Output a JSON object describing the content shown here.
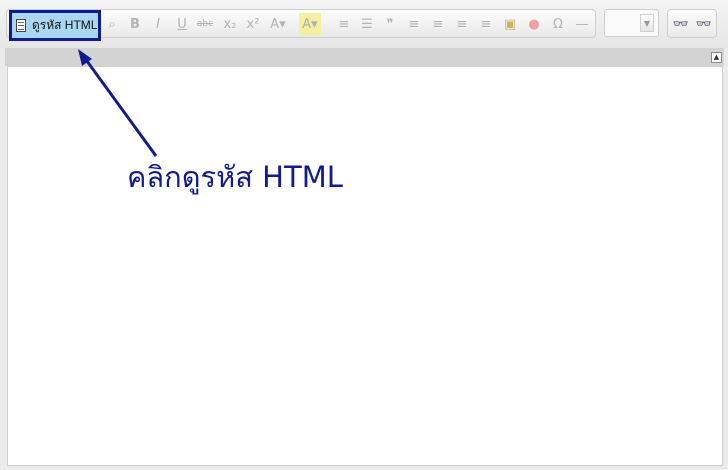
{
  "toolbar": {
    "source_label": "ดูรหัส HTML",
    "buttons": [
      {
        "name": "preview-icon",
        "glyph": "⌕"
      },
      {
        "name": "bold-icon",
        "glyph": "B"
      },
      {
        "name": "italic-icon",
        "glyph": "I"
      },
      {
        "name": "underline-icon",
        "glyph": "U"
      },
      {
        "name": "strikethrough-icon",
        "glyph": "abc"
      },
      {
        "name": "subscript-icon",
        "glyph": "x₂"
      },
      {
        "name": "superscript-icon",
        "glyph": "x²"
      },
      {
        "name": "text-color-icon",
        "glyph": "A▾"
      },
      {
        "name": "background-color-icon",
        "glyph": "A▾"
      },
      {
        "name": "numbered-list-icon",
        "glyph": "≡"
      },
      {
        "name": "bulleted-list-icon",
        "glyph": "☰"
      },
      {
        "name": "blockquote-icon",
        "glyph": "❞"
      },
      {
        "name": "align-left-icon",
        "glyph": "≡"
      },
      {
        "name": "align-center-icon",
        "glyph": "≡"
      },
      {
        "name": "align-right-icon",
        "glyph": "≡"
      },
      {
        "name": "justify-icon",
        "glyph": "≡"
      },
      {
        "name": "image-icon",
        "glyph": "▣"
      },
      {
        "name": "flash-icon",
        "glyph": "●"
      },
      {
        "name": "special-character-icon",
        "glyph": "Ω"
      },
      {
        "name": "horizontal-rule-icon",
        "glyph": "—"
      }
    ],
    "find_glyph": "👓",
    "replace_glyph": "👓"
  },
  "callout": {
    "text": "คลิกดูรหัส HTML",
    "color": "#111b8f"
  },
  "colors": {
    "highlight_border": "#111b8f",
    "highlight_fill": "#a9d7f2"
  }
}
